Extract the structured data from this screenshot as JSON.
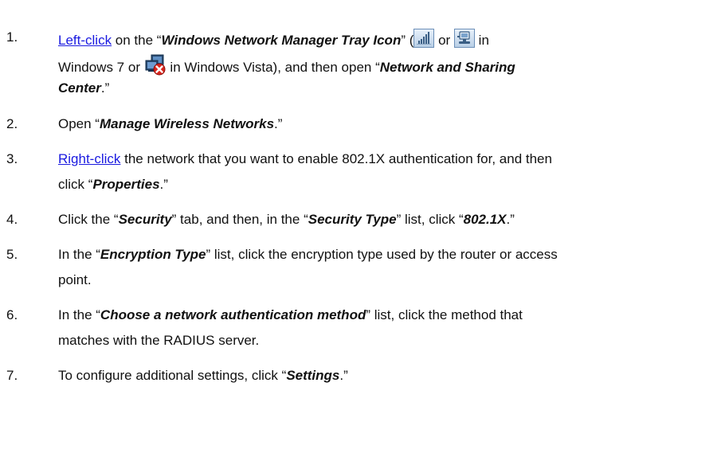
{
  "steps": [
    {
      "number": "1.",
      "lines": [
        {
          "link": "Left-click",
          "t1": " on the “",
          "b1": "Windows Network Manager Tray Icon",
          "t2": "” (",
          "t3": " or ",
          "t4": " in"
        },
        {
          "t1": "Windows 7 or ",
          "t2": " in Windows Vista), and then open “",
          "b1": "Network and Sharing"
        },
        {
          "b1": "Center",
          "t1": ".”"
        }
      ]
    },
    {
      "number": "2.",
      "lines": [
        {
          "t1": "Open “",
          "b1": "Manage Wireless Networks",
          "t2": ".”"
        }
      ]
    },
    {
      "number": "3.",
      "lines": [
        {
          "link": "Right-click",
          "t1": " the network that you want to enable 802.1X authentication for, and then"
        },
        {
          "t1": "click “",
          "b1": "Properties",
          "t2": ".”"
        }
      ]
    },
    {
      "number": "4.",
      "lines": [
        {
          "t1": "Click the “",
          "b1": "Security",
          "t2": "” tab, and then, in the “",
          "b2": "Security Type",
          "t3": "” list, click “",
          "b3": "802.1X",
          "t4": ".”"
        }
      ]
    },
    {
      "number": "5.",
      "lines": [
        {
          "t1": "In the “",
          "b1": "Encryption Type",
          "t2": "” list, click the encryption type used by the router or access"
        },
        {
          "t1": "point."
        }
      ]
    },
    {
      "number": "6.",
      "lines": [
        {
          "t1": "In the “",
          "b1": "Choose a network authentication method",
          "t2": "” list, click the method that"
        },
        {
          "t1": "matches with the RADIUS server."
        }
      ]
    },
    {
      "number": "7.",
      "lines": [
        {
          "t1": "To configure additional settings, click “",
          "b1": "Settings",
          "t2": ".”"
        }
      ]
    }
  ],
  "icons": {
    "win7_signal": "wifi-signal-tray-icon",
    "win7_wired": "wired-network-tray-icon",
    "vista": "network-disconnected-tray-icon"
  },
  "colors": {
    "link": "#1a1ae0",
    "text": "#111111"
  }
}
